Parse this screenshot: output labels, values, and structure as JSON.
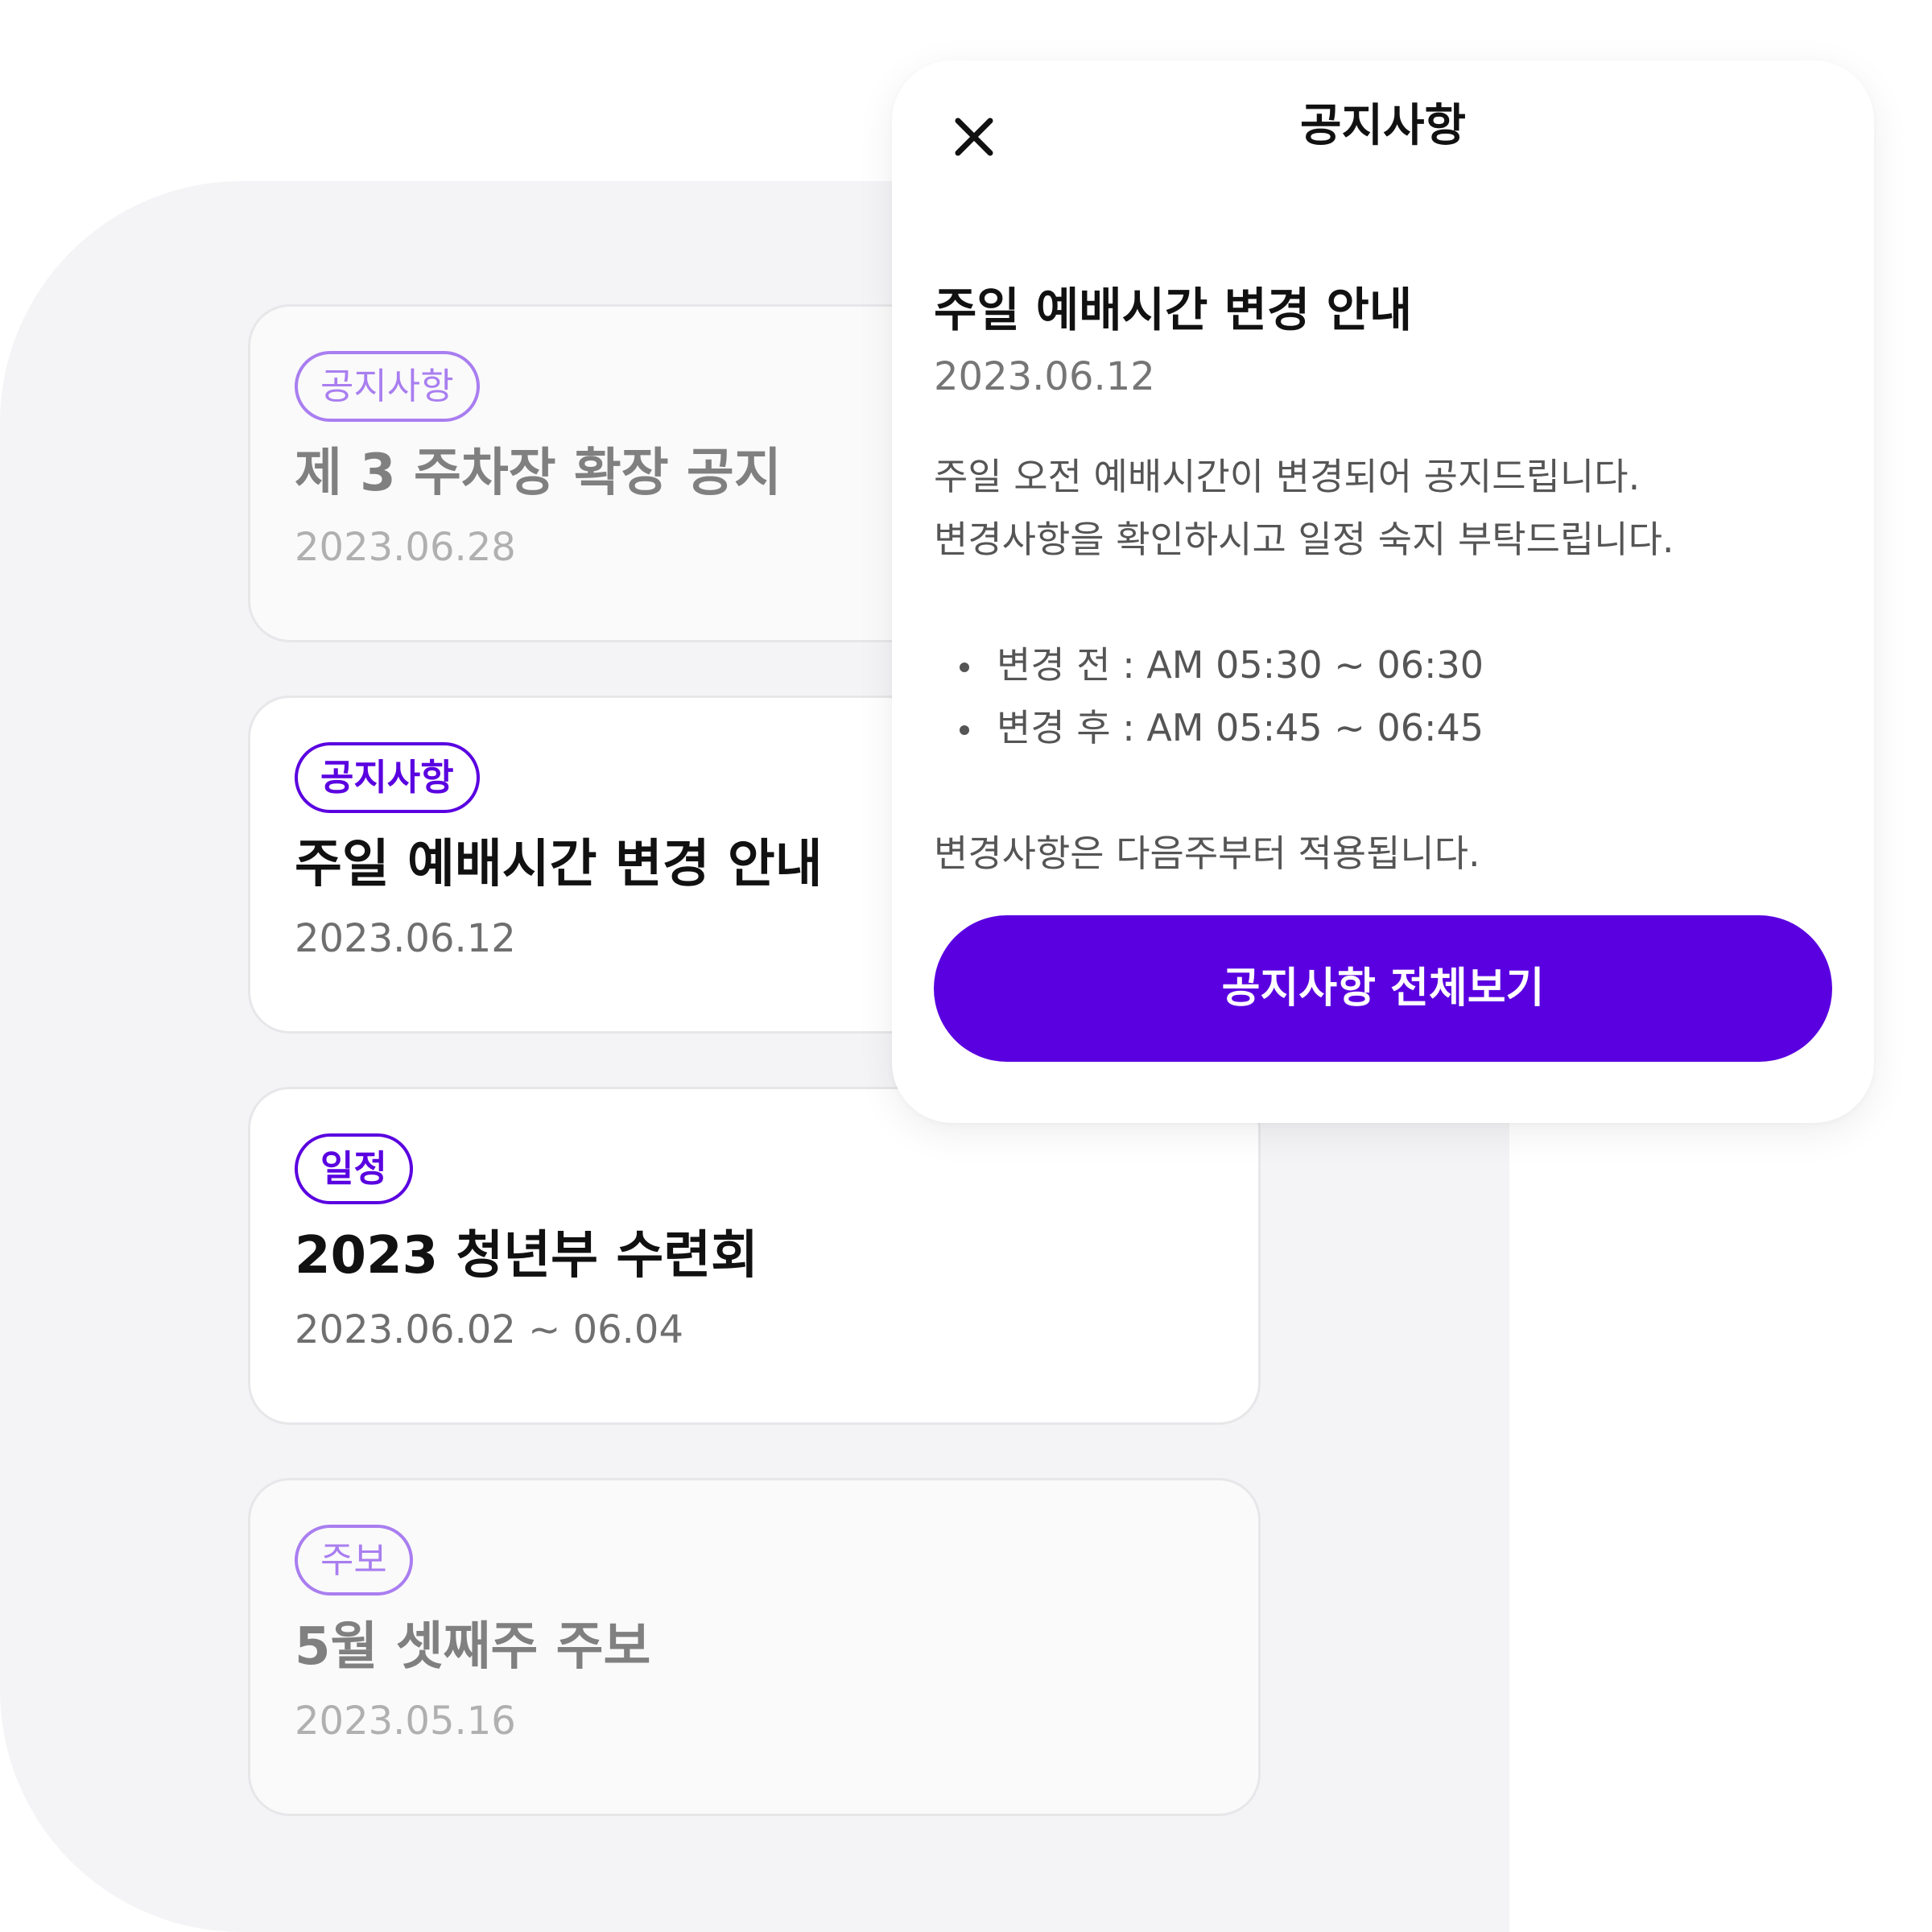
{
  "colors": {
    "accent": "#5a00e0",
    "accent_muted": "#a97ef0",
    "panel_background": "#f4f4f6"
  },
  "notice_list": [
    {
      "tag": "공지사항",
      "title": "제 3 주차장 확장 공지",
      "date": "2023.06.28",
      "state": "dimmed"
    },
    {
      "tag": "공지사항",
      "title": "주일 예배시간 변경 안내",
      "date": "2023.06.12",
      "state": "active"
    },
    {
      "tag": "일정",
      "title": "2023 청년부 수련회",
      "date": "2023.06.02 ~ 06.04",
      "state": "active"
    },
    {
      "tag": "주보",
      "title": "5월 셋째주 주보",
      "date": "2023.05.16",
      "state": "dimmed"
    }
  ],
  "modal": {
    "header_title": "공지사항",
    "close_icon": "close-icon",
    "notice_title": "주일 예배시간 변경 안내",
    "notice_date": "2023.06.12",
    "body_lines": [
      "주일 오전 예배시간이 변경되어 공지드립니다.",
      "변경사항을 확인하시고 일정 숙지 부탁드립니다."
    ],
    "bullets": [
      "변경 전 : AM 05:30 ~ 06:30",
      "변경 후 : AM 05:45 ~ 06:45"
    ],
    "footnote": "변경사항은 다음주부터 적용됩니다.",
    "cta_label": "공지사항 전체보기"
  }
}
